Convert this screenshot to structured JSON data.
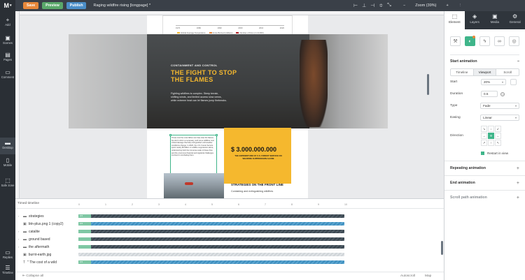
{
  "topbar": {
    "logo": "M",
    "save": "Save",
    "preview": "Preview",
    "publish": "Publish",
    "title": "Raging wildfire rising [longpage] *",
    "zoom": "Zoom (39%)"
  },
  "leftbar": {
    "items": [
      {
        "label": "Add",
        "icon": "plus-icon"
      },
      {
        "label": "Scenes",
        "icon": "scenes-icon"
      },
      {
        "label": "Pages",
        "icon": "pages-icon"
      },
      {
        "label": "Comment",
        "icon": "comment-icon"
      },
      {
        "label": "Desktop",
        "icon": "desktop-icon"
      },
      {
        "label": "Mobile",
        "icon": "mobile-icon"
      },
      {
        "label": "Safe zone",
        "icon": "safe-zone-icon"
      },
      {
        "label": "Replies",
        "icon": "replies-icon"
      },
      {
        "label": "Timeline",
        "icon": "timeline-icon"
      }
    ]
  },
  "canvas": {
    "chart_ticks": [
      "1970",
      "1980",
      "1990",
      "2000",
      "2010",
      "2020"
    ],
    "legend": [
      "Global Average Temperature",
      "Acres Burned (millions)",
      "Number of Fires (in 10,000)"
    ],
    "kicker": "CONTAINMENT AND CONTROL",
    "hero_title": "THE FIGHT TO STOP THE FLAMES",
    "hero_body": "Fighting wildfires is complex. Steep terrain, shifting winds, and limited access slow crews, while extreme heat can let flames jump firebreaks.",
    "selected_text": "Those cost the most billion can help slow the flames, but don't inform a necessary, and some wildfires cost critical damage that fully extinguished until weather conditions change. In 2020, the U.S. Forest Service spent nearly $3 billion on wildfire suppression alone, underscoring both the immense scale of these fires and the enormous financial and logistical challenges involved in combating them.",
    "big_number": "$ 3.000.000.000",
    "big_number_sub": "THE EXPENDITURE OF U.S. FOREST SERVICE ON WILDFIRE SUPPRESSION ALONE",
    "front_title": "STRATEGIES ON THE FRONT LINE",
    "front_body": "Containing and extinguishing wildfires"
  },
  "panel": {
    "tabs": [
      "Element",
      "Layers",
      "Media",
      "General"
    ],
    "start_animation": "Start animation",
    "segments": [
      "Timeline",
      "Viewport",
      "Scroll"
    ],
    "start_label": "Start",
    "start_value": "20%",
    "duration_label": "Duration",
    "duration_value": "0.5",
    "type_label": "Type",
    "type_value": "Fade",
    "easing_label": "Easing",
    "easing_value": "Linear",
    "direction_label": "Direction",
    "restart": "Restart in view",
    "repeating": "Repeating animation",
    "end": "End animation",
    "scroll_path": "Scroll path animation"
  },
  "timeline": {
    "title": "Timed timeline",
    "ticks": [
      "0",
      "1",
      "2",
      "3",
      "4",
      "5",
      "6",
      "7",
      "8",
      "9",
      "10"
    ],
    "rows": [
      {
        "name": "strategies",
        "type": "folder"
      },
      {
        "name": "btn-plus.png 1 (copy2)",
        "type": "image"
      },
      {
        "name": "catalite",
        "type": "folder"
      },
      {
        "name": "ground based",
        "type": "folder"
      },
      {
        "name": "the aftermath",
        "type": "folder"
      },
      {
        "name": "burnt-earth.jpg",
        "type": "image"
      },
      {
        "name": "\" The cost of a wild",
        "type": "text"
      }
    ],
    "collapse": "Collapse all",
    "autoscroll": "Autoscroll",
    "map": "Map"
  }
}
